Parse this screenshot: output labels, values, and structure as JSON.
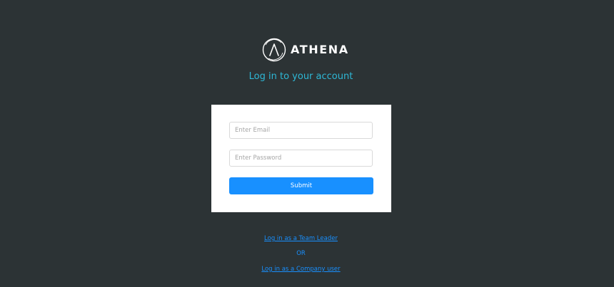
{
  "brand": {
    "name": "ATHENA",
    "logo_icon": "athena-circle-a-icon"
  },
  "login": {
    "heading": "Log in to your account",
    "email_placeholder": "Enter Email",
    "email_value": "",
    "password_placeholder": "Enter Password",
    "password_value": "",
    "submit_label": "Submit"
  },
  "alternatives": {
    "team_leader_link": "Log in as a Team Leader",
    "or_text": "OR",
    "company_user_link": "Log in as a Company user"
  },
  "colors": {
    "background": "#2c3335",
    "heading": "#2eb8d6",
    "primary": "#1890ff",
    "card": "#ffffff"
  }
}
